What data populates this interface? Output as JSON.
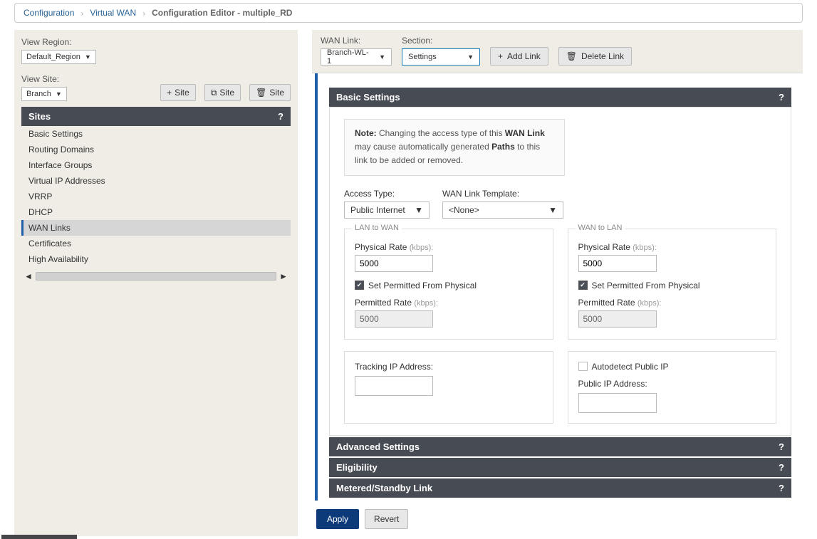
{
  "breadcrumb": {
    "configuration": "Configuration",
    "virtual_wan": "Virtual WAN",
    "current": "Configuration Editor - multiple_RD"
  },
  "left": {
    "view_region_label": "View Region:",
    "view_region_value": "Default_Region",
    "view_site_label": "View Site:",
    "view_site_value": "Branch",
    "add_site": "Site",
    "clone_site": "Site",
    "delete_site": "Site",
    "sites_header": "Sites",
    "help": "?",
    "items": [
      "Basic Settings",
      "Routing Domains",
      "Interface Groups",
      "Virtual IP Addresses",
      "VRRP",
      "DHCP",
      "WAN Links",
      "Certificates",
      "High Availability"
    ]
  },
  "right_top": {
    "wan_link_label": "WAN Link:",
    "wan_link_value": "Branch-WL-1",
    "section_label": "Section:",
    "section_value": "Settings",
    "add_link": "Add Link",
    "delete_link": "Delete Link"
  },
  "panels": {
    "basic": "Basic Settings",
    "advanced": "Advanced Settings",
    "eligibility": "Eligibility",
    "metered": "Metered/Standby Link",
    "help": "?"
  },
  "basic": {
    "note_label": "Note:",
    "note_text1": " Changing the access type of this ",
    "note_bold1": "WAN Link",
    "note_text2": " may cause automatically generated ",
    "note_bold2": "Paths",
    "note_text3": " to this link to be added or removed.",
    "access_type_label": "Access Type:",
    "access_type_value": "Public Internet",
    "template_label": "WAN Link Template:",
    "template_value": "<None>",
    "lan_to_wan": "LAN to WAN",
    "wan_to_lan": "WAN to LAN",
    "physical_rate_label": "Physical Rate ",
    "physical_rate_unit": "(kbps):",
    "physical_value_l": "5000",
    "physical_value_r": "5000",
    "set_permitted": "Set Permitted From Physical",
    "permitted_rate_label": "Permitted Rate ",
    "permitted_rate_unit": "(kbps):",
    "permitted_value_l": "5000",
    "permitted_value_r": "5000",
    "tracking_label": "Tracking IP Address:",
    "autodetect_label": "Autodetect Public IP",
    "public_ip_label": "Public IP Address:"
  },
  "actions": {
    "apply": "Apply",
    "revert": "Revert"
  }
}
